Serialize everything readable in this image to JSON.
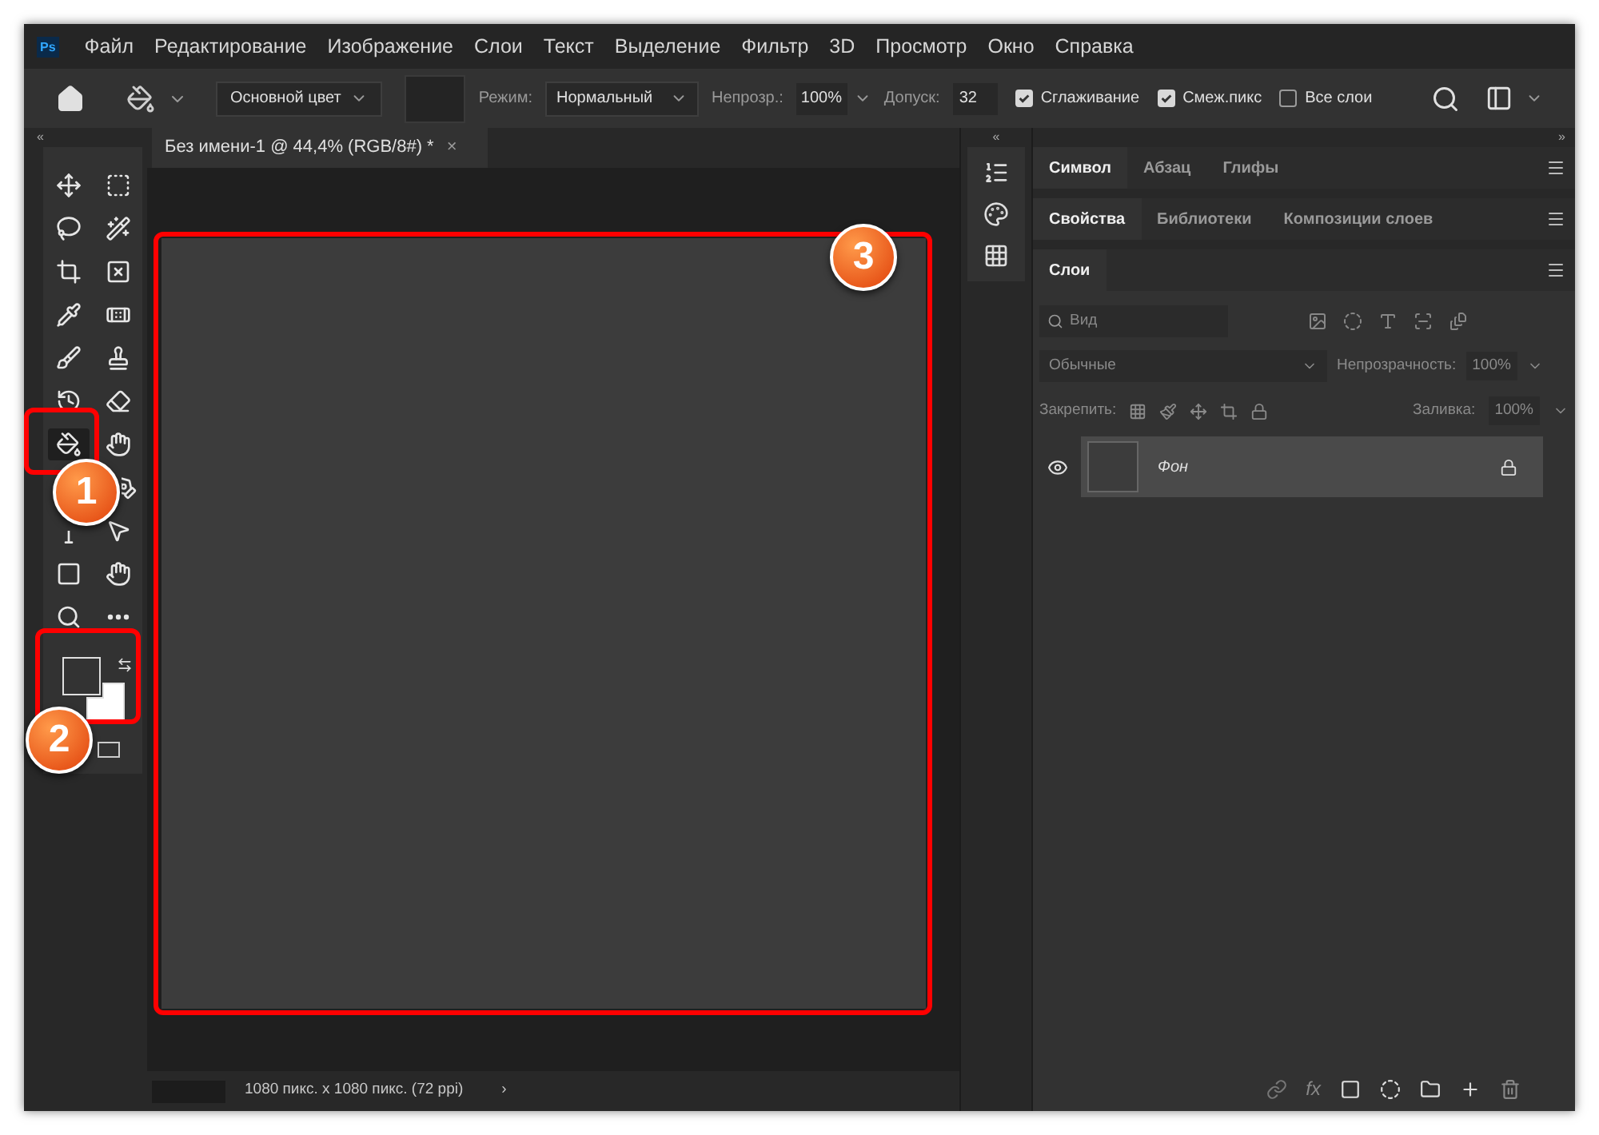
{
  "app_icon": "Ps",
  "menu": [
    "Файл",
    "Редактирование",
    "Изображение",
    "Слои",
    "Текст",
    "Выделение",
    "Фильтр",
    "3D",
    "Просмотр",
    "Окно",
    "Справка"
  ],
  "options_bar": {
    "fill_source": "Основной цвет",
    "mode_label": "Режим:",
    "mode": "Нормальный",
    "opacity_label": "Непрозр.:",
    "opacity": "100%",
    "tolerance_label": "Допуск:",
    "tolerance": "32",
    "checkboxes": [
      {
        "label": "Сглаживание",
        "checked": true
      },
      {
        "label": "Смеж.пикс",
        "checked": true
      },
      {
        "label": "Все слои",
        "checked": false
      }
    ]
  },
  "tools": [
    {
      "kind": "move",
      "selected": false
    },
    {
      "kind": "marquee",
      "selected": false
    },
    {
      "kind": "lasso",
      "selected": false
    },
    {
      "kind": "wand",
      "selected": false
    },
    {
      "kind": "crop",
      "selected": false
    },
    {
      "kind": "frame",
      "selected": false
    },
    {
      "kind": "eyedropper",
      "selected": false
    },
    {
      "kind": "healing",
      "selected": false
    },
    {
      "kind": "brush",
      "selected": false
    },
    {
      "kind": "stamp",
      "selected": false
    },
    {
      "kind": "history",
      "selected": false
    },
    {
      "kind": "eraser",
      "selected": false
    },
    {
      "kind": "bucket",
      "selected": true
    },
    {
      "kind": "smudge",
      "selected": false
    },
    {
      "kind": "pen",
      "selected": false
    },
    {
      "kind": "type",
      "selected": false
    },
    {
      "kind": "pointer",
      "selected": false
    },
    {
      "kind": "shape",
      "selected": false
    },
    {
      "kind": "hand",
      "selected": false
    },
    {
      "kind": "zoom",
      "selected": false
    },
    {
      "kind": "more",
      "selected": false
    }
  ],
  "swatches": [
    {
      "kind": "foreground",
      "color": "#333333"
    },
    {
      "kind": "background",
      "color": "#ffffff"
    }
  ],
  "document_tab": {
    "title": "Без имени-1 @ 44,4% (RGB/8#) *",
    "close": "×"
  },
  "status_bar": {
    "text": "1080 пикс. x 1080 пикс. (72 ppi)",
    "arrow": "›"
  },
  "panel_groups": [
    {
      "tabs": [
        {
          "label": "Символ",
          "selected": true
        },
        {
          "label": "Абзац",
          "selected": false
        },
        {
          "label": "Глифы",
          "selected": false
        }
      ]
    },
    {
      "tabs": [
        {
          "label": "Свойства",
          "selected": true
        },
        {
          "label": "Библиотеки",
          "selected": false
        },
        {
          "label": "Композиции слоев",
          "selected": false
        }
      ]
    },
    {
      "tabs": [
        {
          "label": "Слои",
          "selected": true
        }
      ]
    }
  ],
  "layers": {
    "filter_placeholder": "Вид",
    "blend_mode": "Обычные",
    "opacity_label": "Непрозрачность:",
    "opacity": "100%",
    "lock_label": "Закрепить:",
    "fill_label": "Заливка:",
    "fill": "100%",
    "items": [
      {
        "name": "Фон",
        "visible": true,
        "locked": true
      }
    ]
  },
  "dock_toggles": {
    "left": "«",
    "middle": "«",
    "right": "»"
  },
  "layer_actions": {
    "effects": "fx"
  },
  "annotations": [
    {
      "number": "1"
    },
    {
      "number": "2"
    },
    {
      "number": "3"
    }
  ]
}
